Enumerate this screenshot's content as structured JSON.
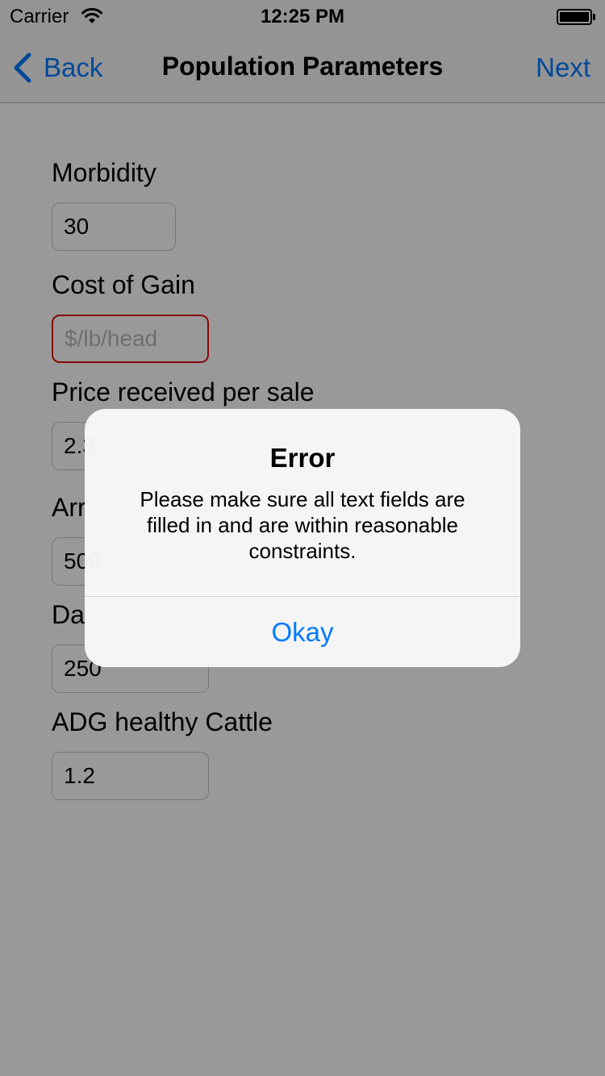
{
  "status_bar": {
    "carrier": "Carrier",
    "wifi_icon": "wifi-icon",
    "time": "12:25 PM",
    "battery_icon": "battery-icon"
  },
  "nav": {
    "back_label": "Back",
    "back_icon": "chevron-left-icon",
    "title": "Population Parameters",
    "next_label": "Next"
  },
  "form": {
    "fields": [
      {
        "label": "Morbidity",
        "value": "30",
        "placeholder": ""
      },
      {
        "label": "Cost of Gain",
        "value": "",
        "placeholder": "$/lb/head",
        "invalid": true
      },
      {
        "label": "Price received per sale",
        "value": "2.3",
        "placeholder": ""
      },
      {
        "label": "Arr",
        "value": "500",
        "placeholder": ""
      },
      {
        "label": "Da",
        "value": "250",
        "placeholder": ""
      },
      {
        "label": "ADG healthy Cattle",
        "value": "1.2",
        "placeholder": ""
      }
    ]
  },
  "alert": {
    "title": "Error",
    "message": "Please make sure all text fields are filled in and are within reasonable constraints.",
    "button_label": "Okay"
  },
  "colors": {
    "accent": "#007aff",
    "error_border": "#e01010",
    "overlay": "rgba(0,0,0,0.4)"
  }
}
